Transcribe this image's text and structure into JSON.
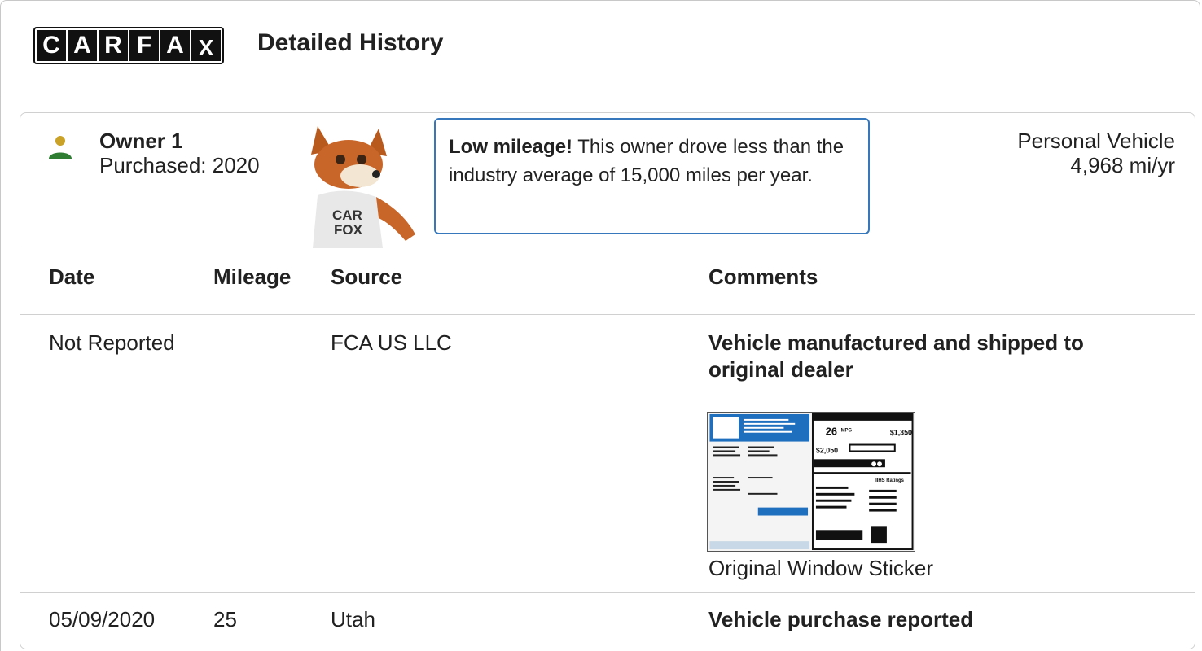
{
  "header": {
    "logo_letters": [
      "C",
      "A",
      "R",
      "F",
      "A",
      "X"
    ],
    "title": "Detailed History"
  },
  "owner": {
    "name": "Owner 1",
    "purchased": "Purchased: 2020",
    "vehicle_type": "Personal Vehicle",
    "mileage_per_year": "4,968 mi/yr",
    "callout_bold": "Low mileage!",
    "callout_text": " This owner drove less than the industry average of 15,000 miles per year.",
    "mascot_shirt": [
      "CAR",
      "FOX"
    ]
  },
  "table": {
    "headers": [
      "Date",
      "Mileage",
      "Source",
      "Comments"
    ],
    "rows": [
      {
        "date": "Not Reported",
        "mileage": "",
        "source": "FCA US LLC",
        "comment": "Vehicle manufactured and shipped to original dealer",
        "attachment_label": "Original Window Sticker",
        "sticker_mpg": "26",
        "sticker_mpg_unit": "MPG",
        "sticker_save": "$1,350",
        "sticker_cost": "$2,050",
        "sticker_ratings": "IIHS Ratings"
      },
      {
        "date": "05/09/2020",
        "mileage": "25",
        "source": "Utah",
        "comment": "Vehicle purchase reported"
      }
    ]
  },
  "colors": {
    "accent_blue": "#3777bc",
    "owner_icon_head": "#c9a227",
    "owner_icon_body": "#2e7d32",
    "border": "#d0d0d0"
  }
}
